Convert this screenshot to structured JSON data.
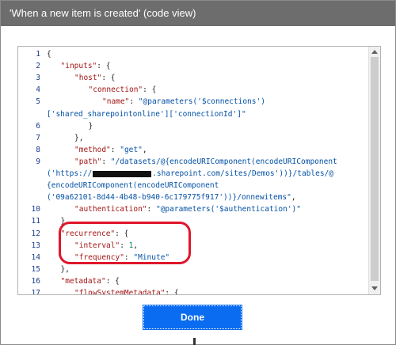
{
  "dialog": {
    "title": "'When a new item is created' (code view)",
    "done_label": "Done"
  },
  "editor": {
    "lines": [
      {
        "n": "1",
        "indent": 0,
        "tokens": [
          [
            "p",
            "{"
          ]
        ]
      },
      {
        "n": "2",
        "indent": 1,
        "tokens": [
          [
            "k",
            "\"inputs\""
          ],
          [
            "p",
            ": {"
          ]
        ]
      },
      {
        "n": "3",
        "indent": 2,
        "tokens": [
          [
            "k",
            "\"host\""
          ],
          [
            "p",
            ": {"
          ]
        ]
      },
      {
        "n": "4",
        "indent": 3,
        "tokens": [
          [
            "k",
            "\"connection\""
          ],
          [
            "p",
            ": {"
          ]
        ]
      },
      {
        "n": "5",
        "indent": 4,
        "tokens": [
          [
            "k",
            "\"name\""
          ],
          [
            "p",
            ": "
          ],
          [
            "s",
            "\"@parameters('$connections')"
          ]
        ]
      },
      {
        "n": "",
        "indent": 0,
        "tokens": [
          [
            "s",
            "['shared_sharepointonline']['connectionId']\""
          ]
        ]
      },
      {
        "n": "6",
        "indent": 3,
        "tokens": [
          [
            "p",
            "}"
          ]
        ]
      },
      {
        "n": "7",
        "indent": 2,
        "tokens": [
          [
            "p",
            "},"
          ]
        ]
      },
      {
        "n": "8",
        "indent": 2,
        "tokens": [
          [
            "k",
            "\"method\""
          ],
          [
            "p",
            ": "
          ],
          [
            "s",
            "\"get\""
          ],
          [
            "p",
            ","
          ]
        ]
      },
      {
        "n": "9",
        "indent": 2,
        "tokens": [
          [
            "k",
            "\"path\""
          ],
          [
            "p",
            ": "
          ],
          [
            "s",
            "\"/datasets/@{encodeURIComponent(encodeURIComponent"
          ]
        ]
      },
      {
        "n": "",
        "indent": 0,
        "tokens": [
          [
            "s",
            "('https://"
          ],
          [
            "r",
            ""
          ],
          [
            "s",
            ".sharepoint.com/sites/Demos'))}/tables/@"
          ]
        ]
      },
      {
        "n": "",
        "indent": 0,
        "tokens": [
          [
            "s",
            "{encodeURIComponent(encodeURIComponent"
          ]
        ]
      },
      {
        "n": "",
        "indent": 0,
        "tokens": [
          [
            "s",
            "('09a62101-8d44-4b48-b940-6c179775f917'))}/onnewitems\""
          ],
          [
            "p",
            ","
          ]
        ]
      },
      {
        "n": "10",
        "indent": 2,
        "tokens": [
          [
            "k",
            "\"authentication\""
          ],
          [
            "p",
            ": "
          ],
          [
            "s",
            "\"@parameters('$authentication')\""
          ]
        ]
      },
      {
        "n": "11",
        "indent": 1,
        "tokens": [
          [
            "p",
            "},"
          ]
        ]
      },
      {
        "n": "12",
        "indent": 1,
        "tokens": [
          [
            "k",
            "\"recurrence\""
          ],
          [
            "p",
            ": {"
          ]
        ]
      },
      {
        "n": "13",
        "indent": 2,
        "tokens": [
          [
            "k",
            "\"interval\""
          ],
          [
            "p",
            ": "
          ],
          [
            "n",
            "1"
          ],
          [
            "p",
            ","
          ]
        ]
      },
      {
        "n": "14",
        "indent": 2,
        "tokens": [
          [
            "k",
            "\"frequency\""
          ],
          [
            "p",
            ": "
          ],
          [
            "s",
            "\"Minute\""
          ]
        ]
      },
      {
        "n": "15",
        "indent": 1,
        "tokens": [
          [
            "p",
            "},"
          ]
        ]
      },
      {
        "n": "16",
        "indent": 1,
        "tokens": [
          [
            "k",
            "\"metadata\""
          ],
          [
            "p",
            ": {"
          ]
        ]
      },
      {
        "n": "17",
        "indent": 2,
        "tokens": [
          [
            "k",
            "\"flowSystemMetadata\""
          ],
          [
            "p",
            ": {"
          ]
        ]
      }
    ]
  }
}
